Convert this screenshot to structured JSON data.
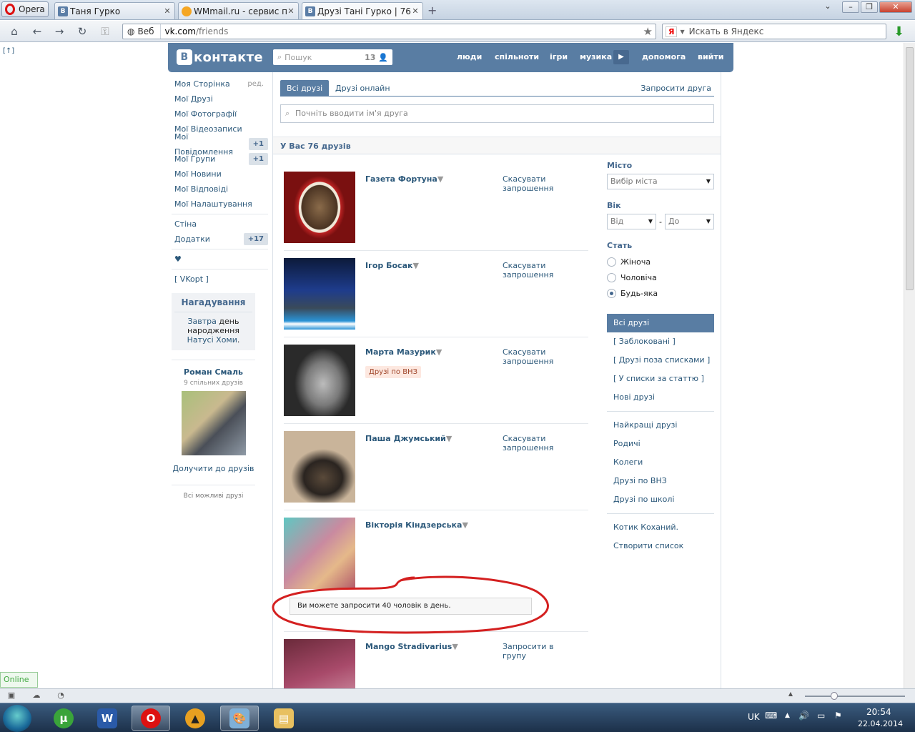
{
  "browser": {
    "menu_label": "Opera",
    "tabs": [
      {
        "favicon": "В",
        "title": "Таня Гурко"
      },
      {
        "favicon": "WM",
        "title": "WMmail.ru - сервис п..."
      },
      {
        "favicon": "В",
        "title": "Друзі Тані Гурко | 76 д..."
      }
    ],
    "web_label": "Веб",
    "url_host": "vk.com",
    "url_path": "/friends",
    "search_placeholder": "Искать в Яндекс",
    "search_engine_badge": "Я"
  },
  "page": {
    "top_link": "[↑]",
    "logo_text": "контакте",
    "logo_letter": "В",
    "search_placeholder": "Пошук",
    "search_count": "13",
    "nav": [
      "люди",
      "спільноти",
      "ігри",
      "музика",
      "допомога",
      "вийти"
    ]
  },
  "left_menu": {
    "items": [
      {
        "label": "Моя Сторінка",
        "extra": "ред."
      },
      {
        "label": "Мої Друзі"
      },
      {
        "label": "Мої Фотографії"
      },
      {
        "label": "Мої Відеозаписи"
      },
      {
        "label": "Мої Повідомлення",
        "badge": "+1"
      },
      {
        "label": "Мої Групи",
        "badge": "+1"
      },
      {
        "label": "Мої Новини"
      },
      {
        "label": "Мої Відповіді"
      },
      {
        "label": "Мої Налаштування"
      }
    ],
    "items2": [
      {
        "label": "Стіна"
      },
      {
        "label": "Додатки",
        "badge": "+17"
      }
    ],
    "heart": "♥",
    "vkopt": "[ VKopt ]"
  },
  "reminder": {
    "title": "Нагадування",
    "word1": "Завтра",
    "word2": "день народження",
    "name": "Натусі Хоми",
    "dot": "."
  },
  "suggestion": {
    "name": "Роман Смаль",
    "mutual": "9 спільних друзів",
    "add": "Долучити до друзів",
    "all": "Всі можливі друзі"
  },
  "friends_page": {
    "tab_all": "Всі друзі",
    "tab_online": "Друзі онлайн",
    "invite": "Запросити друга",
    "search_placeholder": "Почніть вводити ім'я друга",
    "count_text": "У Вас 76 друзів",
    "friends": [
      {
        "name": "Газета Фортуна",
        "action": "Скасувати запрошення"
      },
      {
        "name": "Ігор Босак",
        "action": "Скасувати запрошення"
      },
      {
        "name": "Марта Мазурик",
        "action": "Скасувати запрошення",
        "tag": "Друзі по ВНЗ"
      },
      {
        "name": "Паша Джумський",
        "action": "Скасувати запрошення"
      },
      {
        "name": "Вікторія Кіндзерська",
        "action": ""
      },
      {
        "name": "Mango Stradivarius",
        "action": "Запросити в групу"
      }
    ],
    "notice": "Ви можете запросити 40 чоловік в день."
  },
  "filters": {
    "city_label": "Місто",
    "city_value": "Вибір міста",
    "age_label": "Вік",
    "age_from": "Від",
    "age_to": "До",
    "age_sep": "-",
    "sex_label": "Стать",
    "sex_options": [
      "Жіноча",
      "Чоловіча",
      "Будь-яка"
    ],
    "sex_selected": "Будь-яка"
  },
  "lists": {
    "group1": [
      "Всі друзі",
      "[ Заблоковані ]",
      "[ Друзі поза списками ]",
      "[ У списки за статтю ]",
      "Нові друзі"
    ],
    "group2": [
      "Найкращі друзі",
      "Родичі",
      "Колеги",
      "Друзі по ВНЗ",
      "Друзі по школі"
    ],
    "group3": [
      "Котик Коханий.",
      "Створити список"
    ]
  },
  "status": {
    "online": "Online"
  },
  "taskbar": {
    "lang": "UK",
    "time": "20:54",
    "date": "22.04.2014"
  },
  "colors": {
    "vk_blue": "#597da3",
    "link": "#2b587a",
    "annotation_red": "#d42020"
  }
}
